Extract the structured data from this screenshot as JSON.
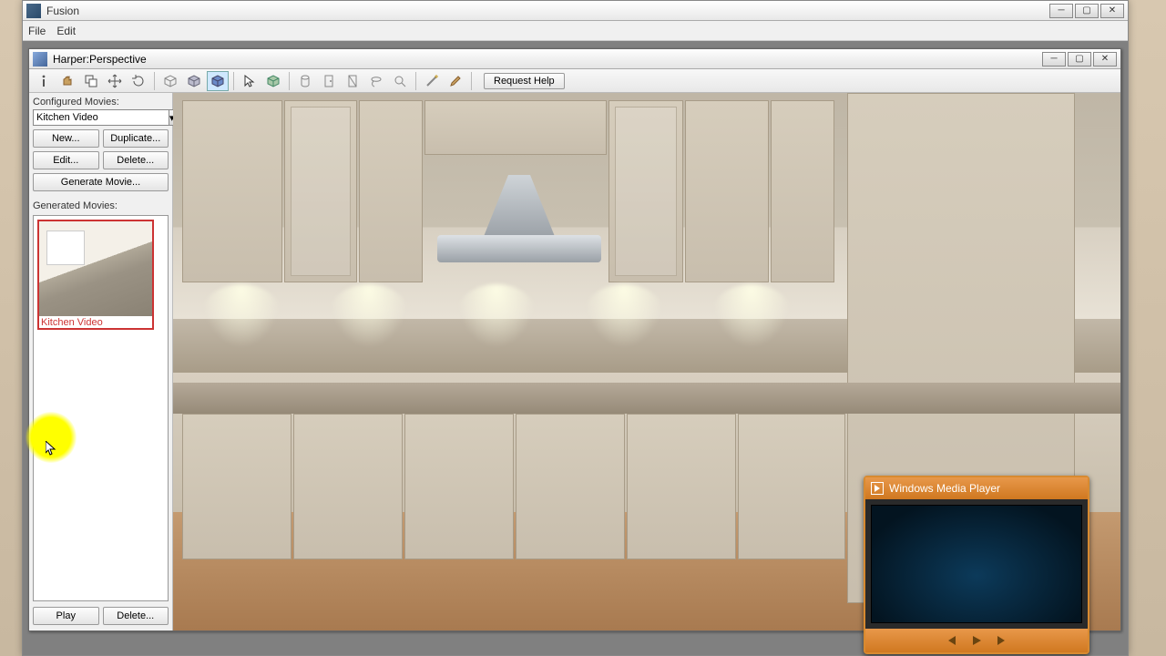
{
  "app": {
    "title": "Fusion",
    "menus": [
      "File",
      "Edit"
    ]
  },
  "doc": {
    "title": "Harper:Perspective"
  },
  "toolbar": {
    "request_help": "Request Help"
  },
  "panel": {
    "configured_label": "Configured Movies:",
    "selected_movie": "Kitchen Video",
    "buttons": {
      "new": "New...",
      "duplicate": "Duplicate...",
      "edit": "Edit...",
      "delete": "Delete...",
      "generate": "Generate Movie...",
      "play": "Play",
      "delete2": "Delete..."
    },
    "generated_label": "Generated Movies:",
    "thumb_caption": "Kitchen Video"
  },
  "wmp": {
    "title": "Windows Media Player"
  },
  "icons": {
    "info": "info-icon",
    "hand": "hand-icon",
    "copy": "copy-icon",
    "move": "move-icon",
    "rotate": "rotate-icon",
    "cube1": "wireframe-icon",
    "cube2": "shaded-icon",
    "cube3": "render-icon",
    "pointer": "pointer-icon",
    "cube_sel": "box-select-icon",
    "cyl": "cylinder-icon",
    "door1": "door-icon",
    "door2": "door2-icon",
    "lasso": "lasso-icon",
    "zoom": "zoom-icon",
    "wand1": "wand-icon",
    "wand2": "brush-icon"
  }
}
